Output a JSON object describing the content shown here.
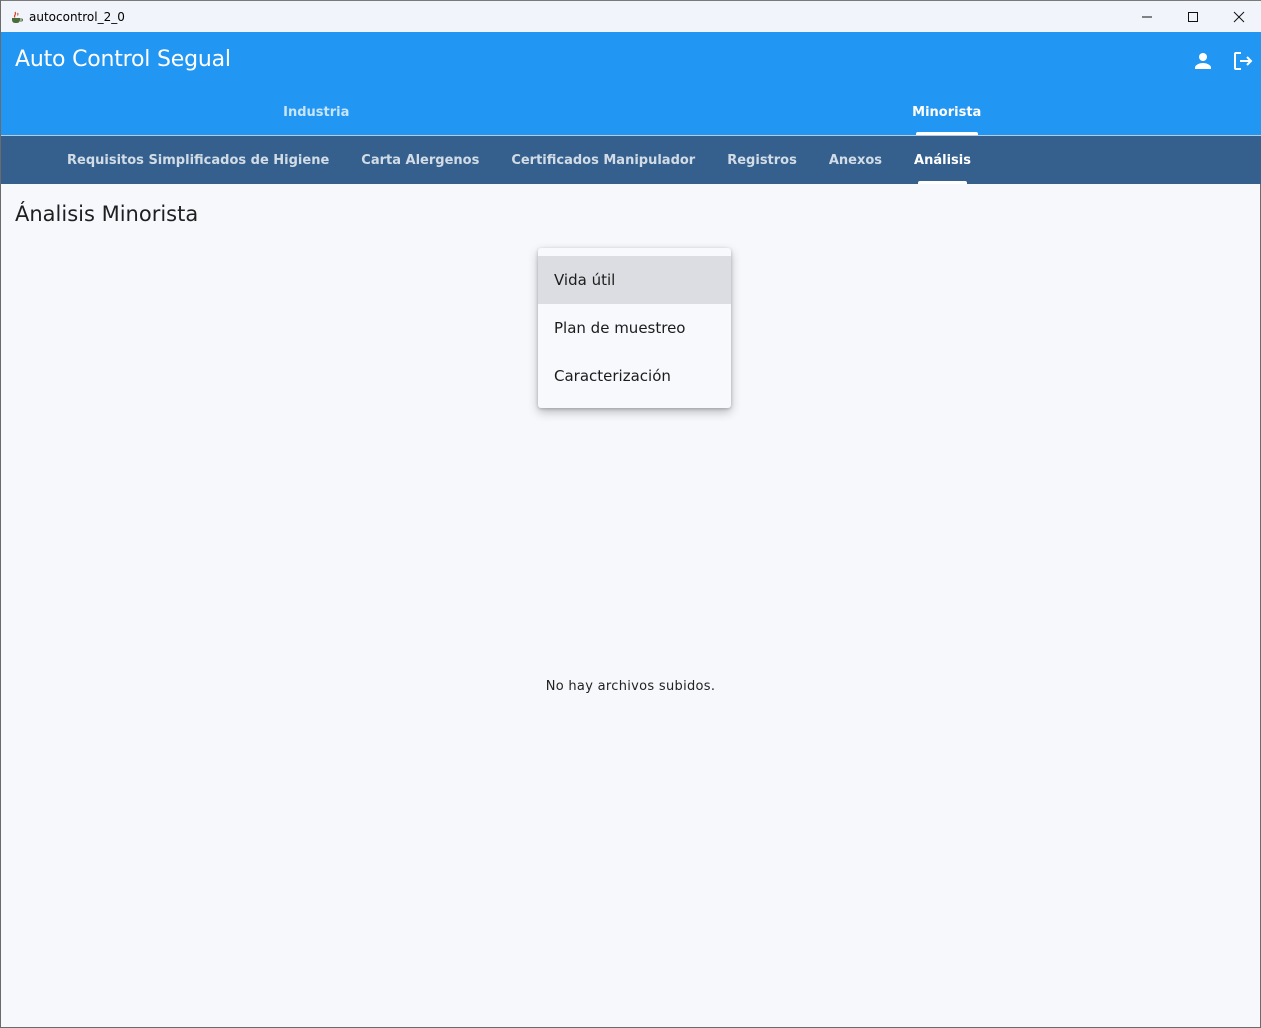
{
  "window": {
    "title": "autocontrol_2_0",
    "icon": "java-cup-icon"
  },
  "appbar": {
    "title": "Auto Control Segual",
    "icons": [
      "person-icon",
      "logout-icon"
    ],
    "color": "#2196f3"
  },
  "main_tabs": [
    {
      "label": "Industria",
      "active": false
    },
    {
      "label": "Minorista",
      "active": true
    }
  ],
  "sub_tabs": [
    {
      "label": "Requisitos Simplificados de Higiene",
      "active": false
    },
    {
      "label": "Carta Alergenos",
      "active": false
    },
    {
      "label": "Certificados Manipulador",
      "active": false
    },
    {
      "label": "Registros",
      "active": false
    },
    {
      "label": "Anexos",
      "active": false
    },
    {
      "label": "Análisis",
      "active": true
    }
  ],
  "subbar_color": "#35608d",
  "page": {
    "title": "Ánalisis Minorista",
    "empty_message": "No hay archivos subidos."
  },
  "menu": {
    "items": [
      {
        "label": "Vida útil",
        "hovered": true
      },
      {
        "label": "Plan de muestreo",
        "hovered": false
      },
      {
        "label": "Caracterización",
        "hovered": false
      }
    ]
  }
}
